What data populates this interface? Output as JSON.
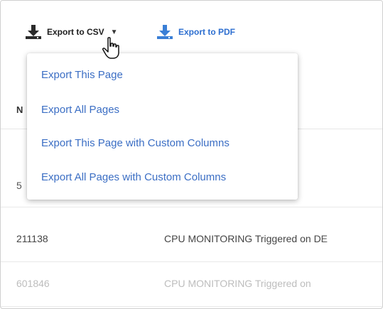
{
  "toolbar": {
    "export_csv_label": "Export to CSV",
    "export_pdf_label": "Export to PDF"
  },
  "dropdown": {
    "items": [
      "Export This Page",
      "Export All Pages",
      "Export This Page with Custom Columns",
      "Export All Pages with Custom Columns"
    ]
  },
  "table": {
    "header_partial": "N",
    "rows": [
      {
        "id": "5",
        "description": ""
      },
      {
        "id": "211138",
        "description": "CPU MONITORING Triggered on DE"
      },
      {
        "id": "601846",
        "description": "CPU MONITORING Triggered on"
      }
    ]
  },
  "colors": {
    "icon_dark": "#2b2b2b",
    "icon_blue": "#3a7fd6",
    "link_blue": "#3b6ec4"
  },
  "icons": {
    "export_csv": "download-icon",
    "export_pdf": "download-icon",
    "dropdown_caret": "caret-down-icon",
    "pointer": "hand-pointer-icon"
  }
}
